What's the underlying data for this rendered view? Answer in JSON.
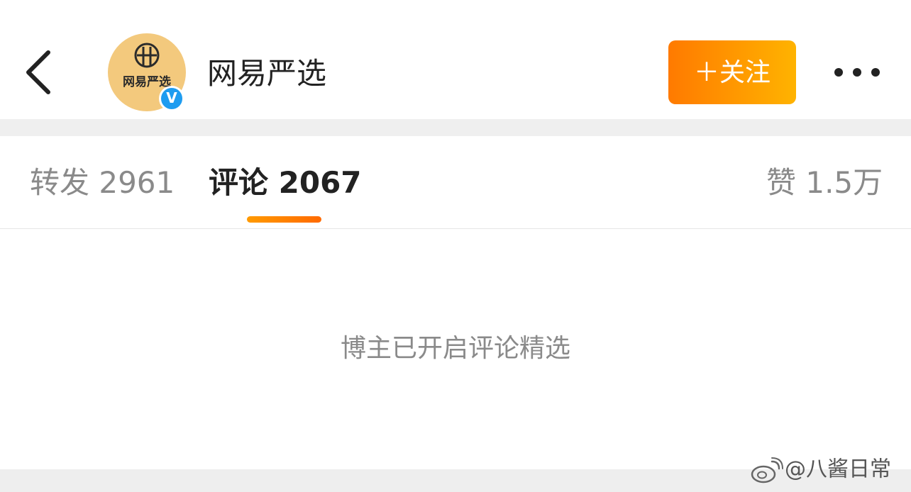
{
  "header": {
    "back_icon": "chevron-left-icon",
    "avatar_brand_text": "网易严选",
    "verified_badge": "V",
    "account_name": "网易严选",
    "follow_label": "＋关注",
    "more_icon": "ellipsis-icon"
  },
  "tabs": {
    "repost": "转发 2961",
    "comment": "评论 2067",
    "like": "赞 1.5万"
  },
  "content": {
    "message": "博主已开启评论精选"
  },
  "watermark": {
    "text": "@八酱日常"
  },
  "colors": {
    "accent_start": "#ff7a00",
    "accent_end": "#ffb300",
    "verified": "#1e9cf0",
    "avatar_bg": "#f3c97d"
  }
}
